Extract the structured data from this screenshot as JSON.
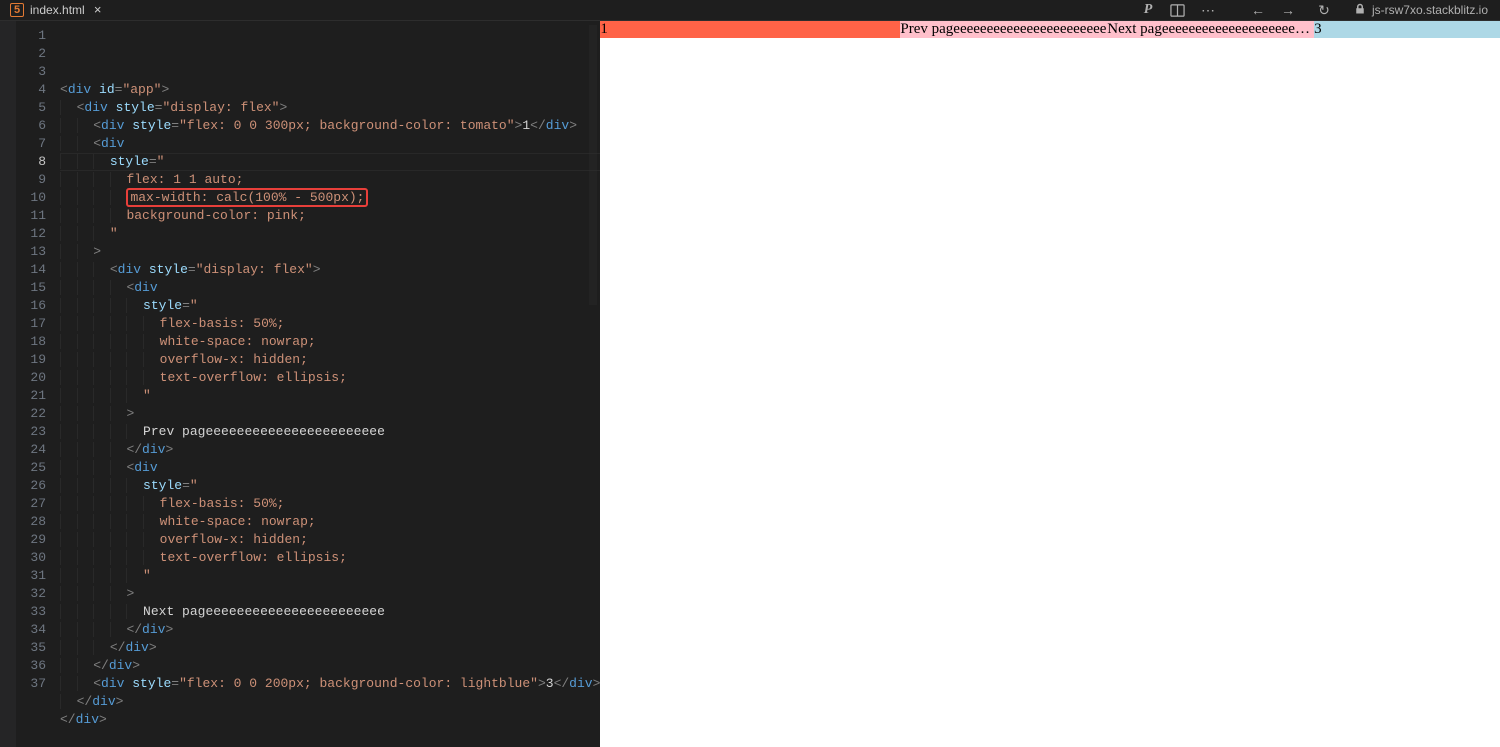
{
  "tab": {
    "filename": "index.html"
  },
  "url": "js-rsw7xo.stackblitz.io",
  "icons": {
    "prettier": "P",
    "layout": "⬛",
    "more": "⋯",
    "back": "←",
    "forward": "→",
    "reload": "↻",
    "close": "×"
  },
  "code": {
    "lines": [
      {
        "n": 1,
        "indent": 0,
        "segs": [
          {
            "c": "tok-punc",
            "t": "<"
          },
          {
            "c": "tok-tag",
            "t": "div"
          },
          {
            "c": "tok-text",
            "t": " "
          },
          {
            "c": "tok-attr",
            "t": "id"
          },
          {
            "c": "tok-punc",
            "t": "="
          },
          {
            "c": "tok-str",
            "t": "\"app\""
          },
          {
            "c": "tok-punc",
            "t": ">"
          }
        ]
      },
      {
        "n": 2,
        "indent": 1,
        "segs": [
          {
            "c": "tok-punc",
            "t": "<"
          },
          {
            "c": "tok-tag",
            "t": "div"
          },
          {
            "c": "tok-text",
            "t": " "
          },
          {
            "c": "tok-attr",
            "t": "style"
          },
          {
            "c": "tok-punc",
            "t": "="
          },
          {
            "c": "tok-str",
            "t": "\"display: flex\""
          },
          {
            "c": "tok-punc",
            "t": ">"
          }
        ]
      },
      {
        "n": 3,
        "indent": 2,
        "segs": [
          {
            "c": "tok-punc",
            "t": "<"
          },
          {
            "c": "tok-tag",
            "t": "div"
          },
          {
            "c": "tok-text",
            "t": " "
          },
          {
            "c": "tok-attr",
            "t": "style"
          },
          {
            "c": "tok-punc",
            "t": "="
          },
          {
            "c": "tok-str",
            "t": "\"flex: 0 0 300px; background-color: tomato\""
          },
          {
            "c": "tok-punc",
            "t": ">"
          },
          {
            "c": "tok-text",
            "t": "1"
          },
          {
            "c": "tok-punc",
            "t": "</"
          },
          {
            "c": "tok-tag",
            "t": "div"
          },
          {
            "c": "tok-punc",
            "t": ">"
          }
        ]
      },
      {
        "n": 4,
        "indent": 2,
        "segs": [
          {
            "c": "tok-punc",
            "t": "<"
          },
          {
            "c": "tok-tag",
            "t": "div"
          }
        ]
      },
      {
        "n": 5,
        "indent": 3,
        "segs": [
          {
            "c": "tok-attr",
            "t": "style"
          },
          {
            "c": "tok-punc",
            "t": "="
          },
          {
            "c": "tok-str",
            "t": "\""
          }
        ]
      },
      {
        "n": 6,
        "indent": 4,
        "segs": [
          {
            "c": "tok-str",
            "t": "flex: 1 1 auto;"
          }
        ]
      },
      {
        "n": 7,
        "indent": 4,
        "segs": [
          {
            "c": "tok-str redbox",
            "t": "max-width: calc(100% - 500px);"
          }
        ]
      },
      {
        "n": 8,
        "indent": 4,
        "segs": [
          {
            "c": "tok-str",
            "t": "background-color: pink;"
          }
        ],
        "active": true
      },
      {
        "n": 9,
        "indent": 3,
        "segs": [
          {
            "c": "tok-str",
            "t": "\""
          }
        ]
      },
      {
        "n": 10,
        "indent": 2,
        "segs": [
          {
            "c": "tok-punc",
            "t": ">"
          }
        ]
      },
      {
        "n": 11,
        "indent": 3,
        "segs": [
          {
            "c": "tok-punc",
            "t": "<"
          },
          {
            "c": "tok-tag",
            "t": "div"
          },
          {
            "c": "tok-text",
            "t": " "
          },
          {
            "c": "tok-attr",
            "t": "style"
          },
          {
            "c": "tok-punc",
            "t": "="
          },
          {
            "c": "tok-str",
            "t": "\"display: flex\""
          },
          {
            "c": "tok-punc",
            "t": ">"
          }
        ]
      },
      {
        "n": 12,
        "indent": 4,
        "segs": [
          {
            "c": "tok-punc",
            "t": "<"
          },
          {
            "c": "tok-tag",
            "t": "div"
          }
        ]
      },
      {
        "n": 13,
        "indent": 5,
        "segs": [
          {
            "c": "tok-attr",
            "t": "style"
          },
          {
            "c": "tok-punc",
            "t": "="
          },
          {
            "c": "tok-str",
            "t": "\""
          }
        ]
      },
      {
        "n": 14,
        "indent": 6,
        "segs": [
          {
            "c": "tok-str",
            "t": "flex-basis: 50%;"
          }
        ]
      },
      {
        "n": 15,
        "indent": 6,
        "segs": [
          {
            "c": "tok-str",
            "t": "white-space: nowrap;"
          }
        ]
      },
      {
        "n": 16,
        "indent": 6,
        "segs": [
          {
            "c": "tok-str",
            "t": "overflow-x: hidden;"
          }
        ]
      },
      {
        "n": 17,
        "indent": 6,
        "segs": [
          {
            "c": "tok-str",
            "t": "text-overflow: ellipsis;"
          }
        ]
      },
      {
        "n": 18,
        "indent": 5,
        "segs": [
          {
            "c": "tok-str",
            "t": "\""
          }
        ]
      },
      {
        "n": 19,
        "indent": 4,
        "segs": [
          {
            "c": "tok-punc",
            "t": ">"
          }
        ]
      },
      {
        "n": 20,
        "indent": 5,
        "segs": [
          {
            "c": "tok-text",
            "t": "Prev pageeeeeeeeeeeeeeeeeeeeeee"
          }
        ]
      },
      {
        "n": 21,
        "indent": 4,
        "segs": [
          {
            "c": "tok-punc",
            "t": "</"
          },
          {
            "c": "tok-tag",
            "t": "div"
          },
          {
            "c": "tok-punc",
            "t": ">"
          }
        ]
      },
      {
        "n": 22,
        "indent": 4,
        "segs": [
          {
            "c": "tok-punc",
            "t": "<"
          },
          {
            "c": "tok-tag",
            "t": "div"
          }
        ]
      },
      {
        "n": 23,
        "indent": 5,
        "segs": [
          {
            "c": "tok-attr",
            "t": "style"
          },
          {
            "c": "tok-punc",
            "t": "="
          },
          {
            "c": "tok-str",
            "t": "\""
          }
        ]
      },
      {
        "n": 24,
        "indent": 6,
        "segs": [
          {
            "c": "tok-str",
            "t": "flex-basis: 50%;"
          }
        ]
      },
      {
        "n": 25,
        "indent": 6,
        "segs": [
          {
            "c": "tok-str",
            "t": "white-space: nowrap;"
          }
        ]
      },
      {
        "n": 26,
        "indent": 6,
        "segs": [
          {
            "c": "tok-str",
            "t": "overflow-x: hidden;"
          }
        ]
      },
      {
        "n": 27,
        "indent": 6,
        "segs": [
          {
            "c": "tok-str",
            "t": "text-overflow: ellipsis;"
          }
        ]
      },
      {
        "n": 28,
        "indent": 5,
        "segs": [
          {
            "c": "tok-str",
            "t": "\""
          }
        ]
      },
      {
        "n": 29,
        "indent": 4,
        "segs": [
          {
            "c": "tok-punc",
            "t": ">"
          }
        ]
      },
      {
        "n": 30,
        "indent": 5,
        "segs": [
          {
            "c": "tok-text",
            "t": "Next pageeeeeeeeeeeeeeeeeeeeeee"
          }
        ]
      },
      {
        "n": 31,
        "indent": 4,
        "segs": [
          {
            "c": "tok-punc",
            "t": "</"
          },
          {
            "c": "tok-tag",
            "t": "div"
          },
          {
            "c": "tok-punc",
            "t": ">"
          }
        ]
      },
      {
        "n": 32,
        "indent": 3,
        "segs": [
          {
            "c": "tok-punc",
            "t": "</"
          },
          {
            "c": "tok-tag",
            "t": "div"
          },
          {
            "c": "tok-punc",
            "t": ">"
          }
        ]
      },
      {
        "n": 33,
        "indent": 2,
        "segs": [
          {
            "c": "tok-punc",
            "t": "</"
          },
          {
            "c": "tok-tag",
            "t": "div"
          },
          {
            "c": "tok-punc",
            "t": ">"
          }
        ]
      },
      {
        "n": 34,
        "indent": 2,
        "segs": [
          {
            "c": "tok-punc",
            "t": "<"
          },
          {
            "c": "tok-tag",
            "t": "div"
          },
          {
            "c": "tok-text",
            "t": " "
          },
          {
            "c": "tok-attr",
            "t": "style"
          },
          {
            "c": "tok-punc",
            "t": "="
          },
          {
            "c": "tok-str",
            "t": "\"flex: 0 0 200px; background-color: lightblue\""
          },
          {
            "c": "tok-punc",
            "t": ">"
          },
          {
            "c": "tok-text",
            "t": "3"
          },
          {
            "c": "tok-punc",
            "t": "</"
          },
          {
            "c": "tok-tag",
            "t": "div"
          },
          {
            "c": "tok-punc",
            "t": ">"
          }
        ]
      },
      {
        "n": 35,
        "indent": 1,
        "segs": [
          {
            "c": "tok-punc",
            "t": "</"
          },
          {
            "c": "tok-tag",
            "t": "div"
          },
          {
            "c": "tok-punc",
            "t": ">"
          }
        ]
      },
      {
        "n": 36,
        "indent": 0,
        "segs": [
          {
            "c": "tok-punc",
            "t": "</"
          },
          {
            "c": "tok-tag",
            "t": "div"
          },
          {
            "c": "tok-punc",
            "t": ">"
          }
        ]
      },
      {
        "n": 37,
        "indent": 0,
        "segs": []
      }
    ]
  },
  "preview": {
    "col1": "1",
    "col2a": "Prev pageeeeeeeeeeeeeeeeeeeeeee",
    "col2b": "Next pageeeeeeeeeeeeeeeeeeeeeee",
    "col3": "3"
  }
}
